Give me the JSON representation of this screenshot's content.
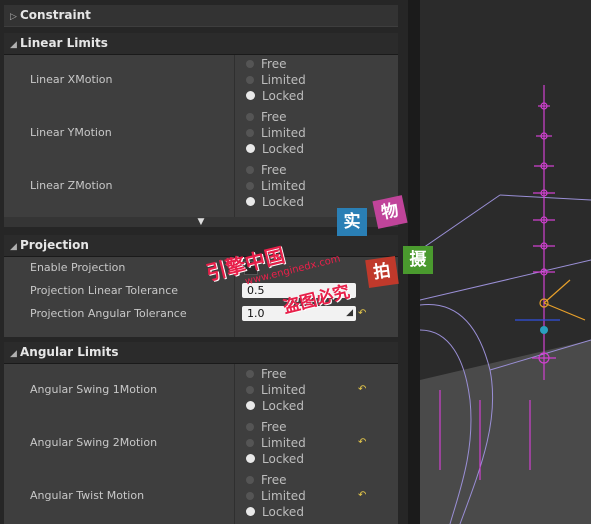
{
  "constraint": {
    "title": "Constraint"
  },
  "linear_limits": {
    "title": "Linear Limits",
    "rows": [
      {
        "label": "Linear XMotion",
        "options": [
          "Free",
          "Limited",
          "Locked"
        ],
        "selected": "Locked"
      },
      {
        "label": "Linear YMotion",
        "options": [
          "Free",
          "Limited",
          "Locked"
        ],
        "selected": "Locked"
      },
      {
        "label": "Linear ZMotion",
        "options": [
          "Free",
          "Limited",
          "Locked"
        ],
        "selected": "Locked"
      }
    ]
  },
  "projection": {
    "title": "Projection",
    "enable_label": "Enable Projection",
    "linear_label": "Projection Linear Tolerance",
    "linear_value": "0.5",
    "angular_label": "Projection Angular Tolerance",
    "angular_value": "1.0"
  },
  "angular_limits": {
    "title": "Angular Limits",
    "rows": [
      {
        "label": "Angular Swing 1Motion",
        "options": [
          "Free",
          "Limited",
          "Locked"
        ],
        "selected": "Locked"
      },
      {
        "label": "Angular Swing 2Motion",
        "options": [
          "Free",
          "Limited",
          "Locked"
        ],
        "selected": "Locked"
      },
      {
        "label": "Angular Twist Motion",
        "options": [
          "Free",
          "Limited",
          "Locked"
        ],
        "selected": "Locked"
      }
    ]
  },
  "watermark": {
    "shi": "实",
    "wu": "物",
    "pai": "拍",
    "she": "摄",
    "line1": "引擎中国",
    "line2": "www.enginedx.com",
    "line3": "盗图必究"
  },
  "colors": {
    "accent_blue": "#2a7fb5",
    "accent_pink": "#c0449a",
    "accent_red": "#c0392b",
    "accent_green": "#4a9a2e",
    "bone": "#d040d0"
  }
}
